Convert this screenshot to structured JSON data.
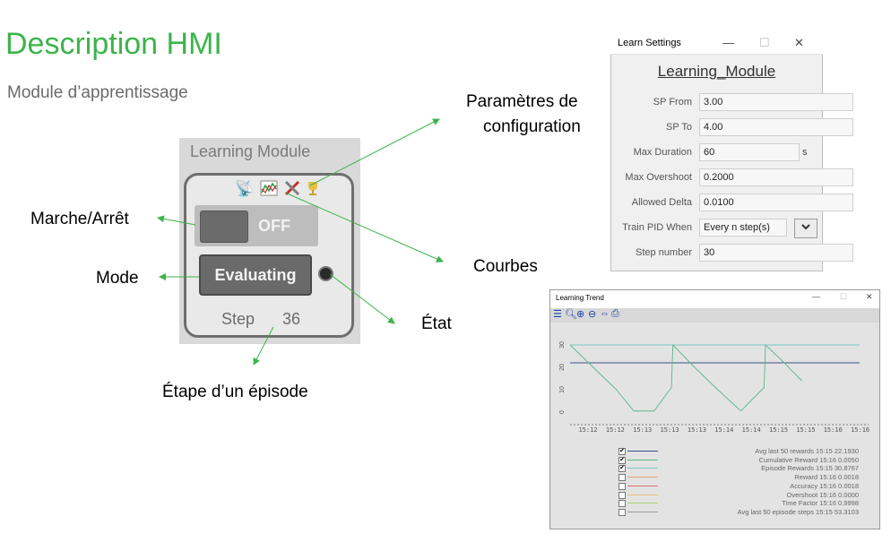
{
  "slide": {
    "title": "Description HMI",
    "subtitle": "Module d’apprentissage",
    "accent_color": "#3cb44b"
  },
  "callouts": {
    "config_line1": "Paramètres de",
    "config_line2": "configuration",
    "marche_arret": "Marche/Arrêt",
    "mode": "Mode",
    "courbes": "Courbes",
    "etat": "État",
    "etape": "Étape d’un épisode"
  },
  "module": {
    "title": "Learning Module",
    "toolbar_icons": [
      "antenna-icon",
      "trend-chart-icon",
      "tools-icon",
      "trophy-icon"
    ],
    "onoff_label": "OFF",
    "mode_label": "Evaluating",
    "step_label": "Step",
    "step_value": "36"
  },
  "learn_settings": {
    "window_title": "Learn Settings",
    "heading": "Learning_Module",
    "fields": [
      {
        "label": "SP From",
        "value": "3.00"
      },
      {
        "label": "SP To",
        "value": "4.00"
      },
      {
        "label": "Max Duration",
        "value": "60"
      },
      {
        "label": "Max Overshoot",
        "value": "0.2000"
      },
      {
        "label": "Allowed Delta",
        "value": "0.0100"
      },
      {
        "label": "Train PID When",
        "value": "Every n step(s)"
      },
      {
        "label": "Step number",
        "value": "30"
      }
    ],
    "duration_unit": "s",
    "select_arrow": "❯"
  },
  "learning_trend": {
    "window_title": "Learning Trend",
    "toolbar_icons": [
      "list-icon",
      "zoom-icon",
      "zoom-in-icon",
      "zoom-out-icon",
      "pan-icon",
      "print-icon"
    ],
    "legend": [
      {
        "name": "Avg last 50 rewards",
        "time": "15:15",
        "value": "22.1930",
        "checked": true,
        "color": "#3b4f8c"
      },
      {
        "name": "Cumulative Reward",
        "time": "15:16",
        "value": "0.0050",
        "checked": true,
        "color": "#5ab88a"
      },
      {
        "name": "Episode Rewards",
        "time": "15:15",
        "value": "30.8767",
        "checked": true,
        "color": "#7ac9c2"
      },
      {
        "name": "Reward",
        "time": "15:16",
        "value": "0.0018",
        "checked": false,
        "color": "#e8a06a"
      },
      {
        "name": "Accuracy",
        "time": "15:16",
        "value": "0.0018",
        "checked": false,
        "color": "#e07070"
      },
      {
        "name": "Overshoot",
        "time": "15:16",
        "value": "0.0000",
        "checked": false,
        "color": "#e8c07a"
      },
      {
        "name": "Time Factor",
        "time": "15:16",
        "value": "0.9998",
        "checked": false,
        "color": "#b0d070"
      },
      {
        "name": "Avg last 50 episode steps",
        "time": "15:15",
        "value": "53.3103",
        "checked": false,
        "color": "#9a9a9a"
      }
    ]
  },
  "chart_data": {
    "type": "line",
    "x_ticks": [
      "15:12",
      "15:12",
      "15:13",
      "15:13",
      "15:13",
      "15:14",
      "15:14",
      "15:15",
      "15:15",
      "15:16",
      "15:16"
    ],
    "y_ticks": [
      "0",
      "10",
      "20",
      "30"
    ],
    "ylim": [
      0,
      32
    ],
    "series": [
      {
        "name": "Avg last 50 rewards",
        "color": "#3b4f8c",
        "x": [
          0,
          10
        ],
        "y": [
          22,
          22
        ]
      },
      {
        "name": "Cumulative Reward",
        "color": "#5ab88a",
        "x": [
          0,
          0.8,
          1.6,
          2.2,
          2.9,
          3.5,
          3.55,
          4.3,
          5.1,
          5.9,
          6.7,
          6.75,
          7.4,
          8.0
        ],
        "y": [
          30,
          20,
          10,
          0.5,
          0.5,
          11,
          30,
          20,
          10,
          0.5,
          11,
          30,
          22,
          14
        ]
      },
      {
        "name": "Episode Rewards",
        "color": "#7ac9c2",
        "x": [
          0,
          10
        ],
        "y": [
          30,
          30
        ]
      }
    ],
    "grid": false,
    "legend_position": "bottom"
  }
}
